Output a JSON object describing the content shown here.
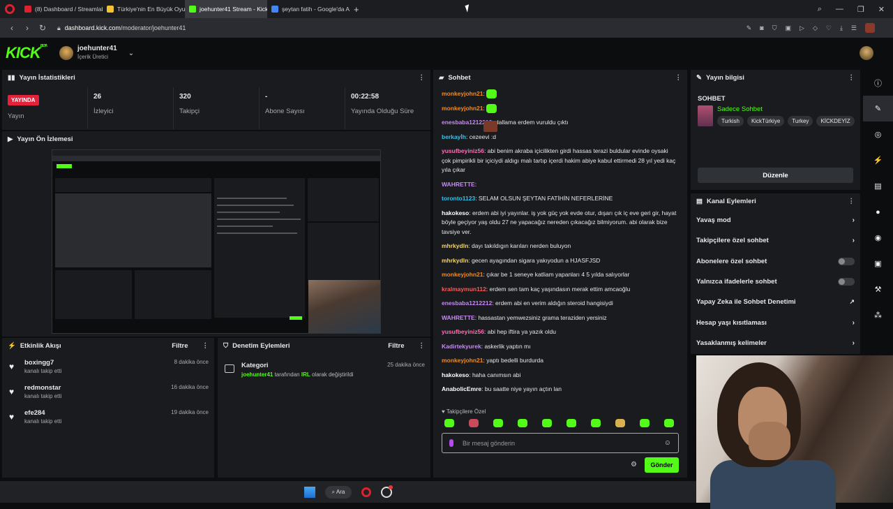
{
  "browser": {
    "tabs": [
      {
        "label": "(8) Dashboard / Streamlab",
        "fav": "#e0202e"
      },
      {
        "label": "Türkiye'nin En Büyük Oyu",
        "fav": "#f2c230"
      },
      {
        "label": "joehunter41 Stream - Kick",
        "fav": "#53fc18"
      },
      {
        "label": "şeytan fatih - Google'da A",
        "fav": "#4285f4"
      }
    ],
    "url_prefix": "dashboard.kick.com",
    "url_path": "/moderator/joehunter41"
  },
  "header": {
    "logo": "KICK",
    "logo_badge": "BETA",
    "username": "joehunter41",
    "role": "İçerik Üretici"
  },
  "stats": {
    "title": "Yayın İstatistikleri",
    "live_badge": "YAYINDA",
    "live_label": "Yayın",
    "viewers_value": "26",
    "viewers_label": "İzleyici",
    "followers_value": "320",
    "followers_label": "Takipçi",
    "subs_value": "-",
    "subs_label": "Abone Sayısı",
    "uptime_value": "00:22:58",
    "uptime_label": "Yayında Olduğu Süre"
  },
  "preview": {
    "title": "Yayın Ön İzlemesi"
  },
  "activity": {
    "title": "Etkinlik Akışı",
    "filter": "Filtre",
    "events": [
      {
        "user": "boxingg7",
        "action": "kanalı takip etti",
        "time": "8 dakika önce"
      },
      {
        "user": "redmonstar",
        "action": "kanalı takip etti",
        "time": "16 dakika önce"
      },
      {
        "user": "efe284",
        "action": "kanalı takip etti",
        "time": "19 dakika önce"
      }
    ]
  },
  "moderation": {
    "title": "Denetim Eylemleri",
    "filter": "Filtre",
    "item_title": "Kategori",
    "item_user": "joehunter41",
    "item_mid": "tarafından",
    "item_category": "IRL",
    "item_end": "olarak değiştirildi",
    "item_time": "25 dakika önce"
  },
  "chat": {
    "title": "Sohbet",
    "messages": [
      {
        "user": "monkeyjohn21",
        "color": "#f08a24",
        "text": "",
        "emote": "green"
      },
      {
        "user": "monkeyjohn21",
        "color": "#f08a24",
        "text": "",
        "emote": "green"
      },
      {
        "user": "enesbaba1212212",
        "color": "#c58bf2",
        "text": "dallama erdem vuruldu çıktı"
      },
      {
        "user": "berkayİh",
        "color": "#2ec4f0",
        "text": "cezeevi :d"
      },
      {
        "user": "yusufbeyiniz56",
        "color": "#ff6fb5",
        "text": "abi benim akraba içicilikten girdi hassas terazi buldular evinde oysaki çok pimpirikli bir içiciydi aldıgı malı tartıp içerdi hakim abiye kabul ettirmedi 28 yıl yedi kaç yıla çıkar"
      },
      {
        "user": "WAHRETTE",
        "color": "#c58bf2",
        "text": "",
        "emote": "face"
      },
      {
        "user": "toronto1123",
        "color": "#2ec4f0",
        "text": "SELAM OLSUN ŞEYTAN FATİHİN NEFERLERİNE"
      },
      {
        "user": "hakokeso",
        "color": "#ffffff",
        "text": "erdem abi iyi yayınlar. iş yok güç yok evde otur, dışarı çık iç eve geri gir, hayat böyle geçiyor yaş oldu 27 ne yapacağız nereden çıkacağız bilmiyorum. abi olarak bize tavsiye ver."
      },
      {
        "user": "mhrkydln",
        "color": "#f4d56a",
        "text": "dayı takıldıgın karıları nerden buluyon"
      },
      {
        "user": "mhrkydln",
        "color": "#f4d56a",
        "text": "gecen ayagından sigara yakıyodun a HJASFJSD"
      },
      {
        "user": "monkeyjohn21",
        "color": "#f08a24",
        "text": "çıkar be 1 seneye katliam yapanları 4 5 yılda salıyorlar"
      },
      {
        "user": "kralmaymun112",
        "color": "#ff5a5a",
        "text": "erdem sen tam kaç yaşındasın merak ettim amcaoğlu"
      },
      {
        "user": "enesbaba1212212",
        "color": "#c58bf2",
        "text": "erdem abi en verim aldığın steroid hangisiydi"
      },
      {
        "user": "WAHRETTE",
        "color": "#c58bf2",
        "text": "hassastan yemwezsiniz grama teraziden yersiniz"
      },
      {
        "user": "yusufbeyiniz56",
        "color": "#ff6fb5",
        "text": "abi hep iftira ya yazık oldu"
      },
      {
        "user": "Kadirtekyurek",
        "color": "#c58bf2",
        "text": "askerlik yaptın mı"
      },
      {
        "user": "monkeyjohn21",
        "color": "#f08a24",
        "text": "yaptı bedelli burdurda"
      },
      {
        "user": "hakokeso",
        "color": "#ffffff",
        "text": "haha canımsın abi"
      },
      {
        "user": "AnabolicEmre",
        "color": "#ffffff",
        "text": "bu saatte niye yayın açtın lan"
      }
    ],
    "followers_only": "Takipçilere Özel",
    "input_placeholder": "Bir mesaj gönderin",
    "send": "Gönder"
  },
  "stream_info": {
    "title": "Yayın bilgisi",
    "section": "SOHBET",
    "stream_title": "Sadece Sohbet",
    "tags": [
      "Turkish",
      "KickTürkiye",
      "Turkey",
      "KİCKDEYİZ"
    ],
    "edit": "Düzenle"
  },
  "channel_actions": {
    "title": "Kanal Eylemleri",
    "items": [
      {
        "label": "Yavaş mod",
        "control": "chevron"
      },
      {
        "label": "Takipçilere özel sohbet",
        "control": "chevron"
      },
      {
        "label": "Abonelere özel sohbet",
        "control": "toggle"
      },
      {
        "label": "Yalnızca ifadelerle sohbet",
        "control": "toggle"
      },
      {
        "label": "Yapay Zeka ile Sohbet Denetimi",
        "control": "external"
      },
      {
        "label": "Hesap yaşı kısıtlaması",
        "control": "chevron"
      },
      {
        "label": "Yasaklanmış kelimeler",
        "control": "chevron"
      }
    ]
  },
  "taskbar": {
    "search": "Ara"
  },
  "colors": {
    "accent": "#53fc18",
    "live": "#e5213b",
    "panel": "#191b1f"
  }
}
